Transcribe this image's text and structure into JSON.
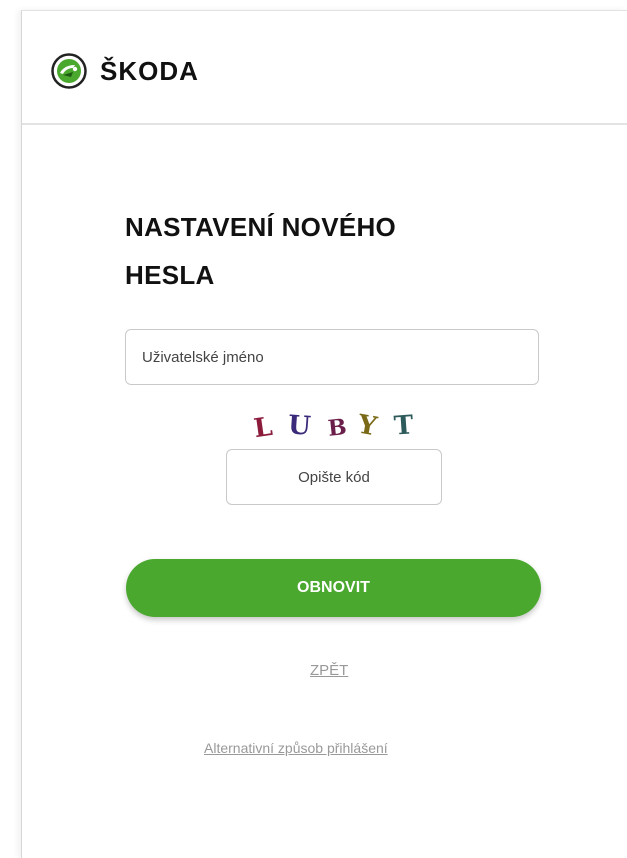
{
  "header": {
    "brand": "ŠKODA",
    "logo_icon": "skoda-arrow-logo-icon"
  },
  "form": {
    "title": "NASTAVENÍ NOVÉHO HESLA",
    "username_placeholder": "Uživatelské jméno",
    "captcha": {
      "letters": [
        "L",
        "U",
        "B",
        "Y",
        "T"
      ],
      "colors": [
        "#8b1a3b",
        "#3b2a7a",
        "#6a1f4a",
        "#7a6a18",
        "#2d5a5a"
      ]
    },
    "code_placeholder": "Opište kód",
    "submit_label": "OBNOVIT",
    "back_label": "ZPĚT",
    "alt_login_label": "Alternativní způsob přihlášení"
  },
  "colors": {
    "accent": "#4ba82e",
    "link": "#999999"
  }
}
